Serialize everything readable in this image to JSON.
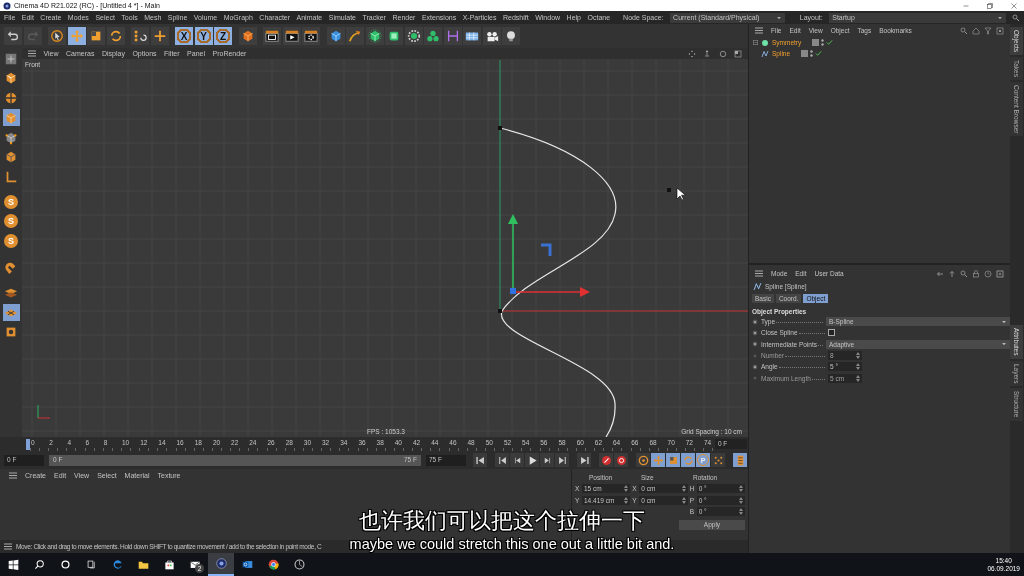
{
  "window": {
    "title": "Cinema 4D R21.022 (RC) - [Untitled 4 *] - Main"
  },
  "menu_bar": {
    "items": [
      "File",
      "Edit",
      "Create",
      "Modes",
      "Select",
      "Tools",
      "Mesh",
      "Spline",
      "Volume",
      "MoGraph",
      "Character",
      "Animate",
      "Simulate",
      "Tracker",
      "Render",
      "Extensions",
      "X-Particles",
      "Redshift",
      "Window",
      "Help",
      "Octane"
    ],
    "node_space_label": "Node Space:",
    "node_space": "Current (Standard/Physical)",
    "layout_label": "Layout:",
    "layout": "Startup"
  },
  "toolbar": [
    {
      "kind": "undo",
      "selected": false
    },
    {
      "kind": "redo",
      "selected": false
    },
    {
      "kind": "select",
      "selected": false
    },
    {
      "kind": "move",
      "selected": true
    },
    {
      "kind": "scale",
      "selected": false
    },
    {
      "kind": "rotate",
      "selected": false
    },
    {
      "kind": "psr",
      "selected": false
    },
    {
      "kind": "plus",
      "selected": false
    },
    {
      "kind": "axis",
      "label": "X",
      "selected": true
    },
    {
      "kind": "axis",
      "label": "Y",
      "selected": true
    },
    {
      "kind": "axis",
      "label": "Z",
      "selected": true
    },
    {
      "kind": "world",
      "selected": false
    },
    {
      "kind": "render-view",
      "selected": false
    },
    {
      "kind": "render",
      "selected": false
    },
    {
      "kind": "render-settings",
      "selected": false
    },
    {
      "kind": "cube",
      "selected": false
    },
    {
      "kind": "pen",
      "selected": false
    },
    {
      "kind": "subdivision",
      "selected": false
    },
    {
      "kind": "extrude",
      "selected": false
    },
    {
      "kind": "array",
      "selected": false
    },
    {
      "kind": "cloner",
      "selected": false
    },
    {
      "kind": "deformer",
      "selected": false
    },
    {
      "kind": "floor",
      "selected": false
    },
    {
      "kind": "camera",
      "selected": false
    },
    {
      "kind": "light",
      "selected": false
    }
  ],
  "palette": [
    {
      "kind": "make-editable",
      "selected": false
    },
    {
      "kind": "model",
      "selected": false
    },
    {
      "kind": "texture",
      "selected": false
    },
    {
      "kind": "object",
      "selected": true
    },
    {
      "kind": "points",
      "selected": false
    },
    {
      "kind": "polygons",
      "selected": false
    },
    {
      "kind": "axis",
      "selected": false
    },
    {
      "kind": "snap",
      "label": "S",
      "selected": false
    },
    {
      "kind": "snap",
      "label": "S",
      "selected": false
    },
    {
      "kind": "snap",
      "label": "S",
      "selected": false
    },
    {
      "kind": "magnet",
      "selected": false
    },
    {
      "kind": "workplane",
      "selected": false
    },
    {
      "kind": "grid",
      "selected": true
    },
    {
      "kind": "solo",
      "selected": false
    }
  ],
  "viewport": {
    "menu": [
      "View",
      "Cameras",
      "Display",
      "Options",
      "Filter",
      "Panel",
      "ProRender"
    ],
    "camera": "Front",
    "fps": "FPS : 1053.3",
    "grid_spacing": "Grid Spacing : 10 cm"
  },
  "timeline": {
    "ticks": [
      "0",
      "2",
      "4",
      "6",
      "8",
      "10",
      "12",
      "14",
      "16",
      "18",
      "20",
      "22",
      "24",
      "26",
      "28",
      "30",
      "32",
      "34",
      "36",
      "38",
      "40",
      "42",
      "44",
      "46",
      "48",
      "50",
      "52",
      "54",
      "56",
      "58",
      "60",
      "62",
      "64",
      "66",
      "68",
      "70",
      "72",
      "74"
    ],
    "frame": "0 F"
  },
  "transport": {
    "current": "0 F",
    "range_start": "0 F",
    "range_end": "75 F",
    "end": "75 F",
    "buttons": [
      {
        "kind": "goto-start",
        "selected": false
      },
      {
        "kind": "prev-key",
        "selected": false
      },
      {
        "kind": "prev-frame",
        "selected": false
      },
      {
        "kind": "play",
        "selected": false
      },
      {
        "kind": "next-frame",
        "selected": false
      },
      {
        "kind": "next-key",
        "selected": false
      },
      {
        "kind": "goto-end",
        "selected": false
      },
      {
        "kind": "record",
        "selected": false
      },
      {
        "kind": "autokey",
        "selected": false
      },
      {
        "kind": "key-selection",
        "selected": false
      },
      {
        "kind": "key-position",
        "selected": true
      },
      {
        "kind": "key-scale",
        "selected": true
      },
      {
        "kind": "key-rotation",
        "selected": true
      },
      {
        "kind": "key-parameter",
        "label": "P",
        "selected": true
      },
      {
        "kind": "key-pla",
        "selected": false
      },
      {
        "kind": "timeline-window",
        "selected": true
      }
    ]
  },
  "materials": {
    "menu": [
      "Create",
      "Edit",
      "View",
      "Select",
      "Material",
      "Texture"
    ]
  },
  "coordinates": {
    "headers": [
      "Position",
      "Size",
      "Rotation"
    ],
    "rows": [
      {
        "position": {
          "axis": "X",
          "value": "15 cm"
        },
        "size": {
          "axis": "X",
          "value": "0 cm"
        },
        "rotation": {
          "axis": "H",
          "value": "0 °"
        }
      },
      {
        "position": {
          "axis": "Y",
          "value": "14.419 cm"
        },
        "size": {
          "axis": "Y",
          "value": "0 cm"
        },
        "rotation": {
          "axis": "P",
          "value": "0 °"
        }
      },
      {
        "rotation": {
          "axis": "B",
          "value": "0 °"
        }
      }
    ],
    "apply": "Apply"
  },
  "status_bar": {
    "text": "Move: Click and drag to move elements. Hold down SHIFT to quantize movement / add to the selection in point mode, C"
  },
  "objects": {
    "menu": [
      "File",
      "Edit",
      "View",
      "Object",
      "Tags",
      "Bookmarks"
    ],
    "tree": [
      {
        "name": "Symmetry",
        "selected": true,
        "expanded": true,
        "children": [
          {
            "name": "Spline",
            "selected": true
          }
        ]
      }
    ]
  },
  "attributes": {
    "menu": [
      "Mode",
      "Edit",
      "User Data"
    ],
    "title": "Spline [Spline]",
    "tabs": [
      {
        "label": "Basic",
        "selected": false
      },
      {
        "label": "Coord.",
        "selected": false
      },
      {
        "label": "Object",
        "selected": true
      }
    ],
    "section": "Object Properties",
    "params": [
      {
        "kind": "dropdown",
        "label": "Type",
        "value": "B-Spline",
        "disabled": false
      },
      {
        "kind": "checkbox",
        "label": "Close Spline",
        "checked": false,
        "disabled": false
      },
      {
        "kind": "dropdown",
        "label": "Intermediate Points",
        "value": "Adaptive",
        "disabled": false
      },
      {
        "kind": "number",
        "label": "Number",
        "value": "8",
        "disabled": true
      },
      {
        "kind": "number",
        "label": "Angle",
        "value": "5 °",
        "disabled": false
      },
      {
        "kind": "number",
        "label": "Maximum Length",
        "value": "5 cm",
        "disabled": true
      }
    ]
  },
  "side_tabs": {
    "top": [
      {
        "label": "Objects",
        "selected": true
      },
      {
        "label": "Takes",
        "selected": false
      },
      {
        "label": "Content Browser",
        "selected": false
      }
    ],
    "bottom": [
      {
        "label": "Attributes",
        "selected": true
      },
      {
        "label": "Layers",
        "selected": false
      },
      {
        "label": "Structure",
        "selected": false
      }
    ]
  },
  "subtitles": {
    "chinese": "也许我们可以把这个拉伸一下",
    "english": "maybe we could stretch this one out a little bit and."
  },
  "taskbar": {
    "apps": [
      {
        "kind": "start",
        "selected": false
      },
      {
        "kind": "search",
        "selected": false
      },
      {
        "kind": "cortana",
        "selected": false
      },
      {
        "kind": "taskview",
        "selected": false
      },
      {
        "kind": "edge",
        "selected": false
      },
      {
        "kind": "explorer",
        "selected": false
      },
      {
        "kind": "store",
        "selected": false
      },
      {
        "kind": "mail",
        "badge": "2",
        "selected": false
      },
      {
        "kind": "cinema",
        "selected": true
      },
      {
        "kind": "outlook",
        "selected": false
      },
      {
        "kind": "chrome",
        "selected": false
      },
      {
        "kind": "other",
        "selected": false
      }
    ],
    "time": "15:40",
    "date": "06.09.2019"
  }
}
